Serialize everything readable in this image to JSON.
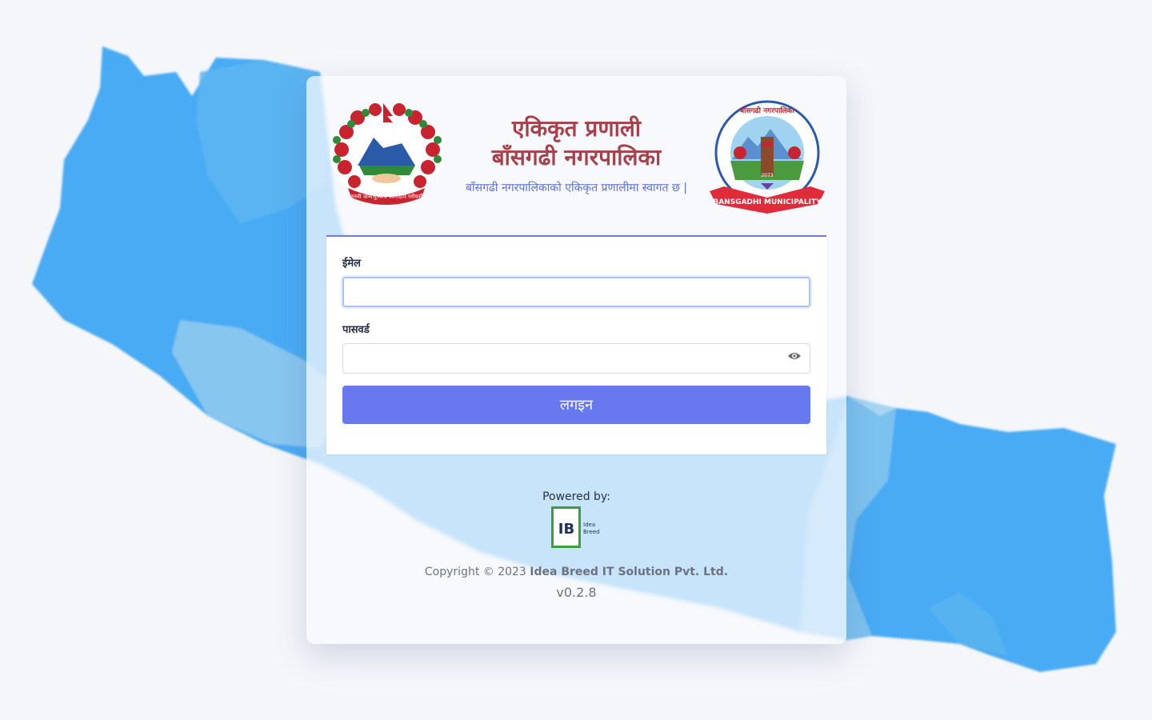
{
  "header": {
    "title_line1": "एकिकृत प्रणाली",
    "title_line2": "बाँसगढी नगरपालिका",
    "subtitle": "बाँसगढी नगरपालिकाको एकिकृत प्रणालीमा स्वागत छ |",
    "left_emblem": "nepal-government-emblem",
    "left_emblem_motto": "जननी जन्मभूमिश्च स्वर्गादपि गरीयसी",
    "right_emblem": "bansgadhi-municipality-logo",
    "right_emblem_top_text": "बाँसगढी नगरपालिका",
    "right_emblem_banner": "BANSGADHI MUNICIPALITY",
    "right_emblem_year": "2073"
  },
  "form": {
    "email_label": "ईमेल",
    "email_value": "",
    "password_label": "पासवर्ड",
    "password_value": "",
    "password_toggle_icon": "eye-icon",
    "login_label": "लगइन"
  },
  "footer": {
    "powered_by": "Powered by:",
    "logo_letters": "IB",
    "logo_text_1": "Idea",
    "logo_text_2": "Breed",
    "copyright_prefix": "Copyright © 2023 ",
    "company": "Idea Breed IT Solution Pvt. Ltd.",
    "version": "v0.2.8"
  },
  "colors": {
    "accent": "#6878ee",
    "title": "#a8404a",
    "subtitle": "#5a6fd0",
    "map_blue": "#3ea6f3"
  }
}
